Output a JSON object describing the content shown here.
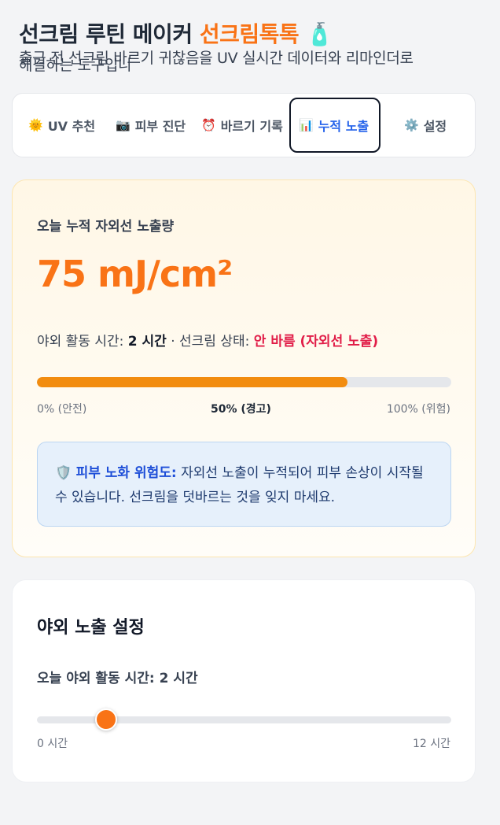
{
  "header": {
    "title": "선크림 루틴 메이커",
    "brand": "선크림톡톡",
    "brand_icon": "🧴",
    "subtitle_line1": "출근 전 선크림 바르기 귀찮음을 UV 실시간 데이터와 리마인더로",
    "subtitle_line2": "해결하는 도구입니"
  },
  "tabs": [
    {
      "icon": "🌞",
      "label": "UV 추천"
    },
    {
      "icon": "📷",
      "label": "피부 진단"
    },
    {
      "icon": "⏰",
      "label": "바르기 기록"
    },
    {
      "icon": "📊",
      "label": "누적 노출",
      "active": true
    },
    {
      "icon": "⚙️",
      "label": "설정"
    }
  ],
  "exposure": {
    "label": "오늘 누적 자외선 노출량",
    "value": "75 mJ/cm²",
    "activity_prefix": "야외 활동 시간: ",
    "activity_hours": "2 시간",
    "sunscreen_prefix": " · 선크림 상태: ",
    "sunscreen_status": "안 바름 (자외선 노출)",
    "progress_fraction": 0.75,
    "scale_left": "0% (안전)",
    "scale_mid": "50% (경고)",
    "scale_right": "100% (위험)",
    "risk_icon": "🛡️",
    "risk_title": "피부 노화 위험도:",
    "risk_text": " 자외선 노출이 누적되어 피부 손상이 시작될 수 있습니다. 선크림을 덧바르는 것을 잊지 마세요."
  },
  "settings": {
    "title": "야외 노출 설정",
    "slider_prefix": "오늘 야외 활동 시간: ",
    "slider_value_text": "2 시간",
    "slider_value": 2,
    "slider_min": 0,
    "slider_max": 12,
    "min_label": "0 시간",
    "max_label": "12 시간"
  },
  "colors": {
    "accent": "#f97316",
    "active_tab": "#2563eb",
    "danger": "#e11d48",
    "progress": "#f28c0f"
  }
}
